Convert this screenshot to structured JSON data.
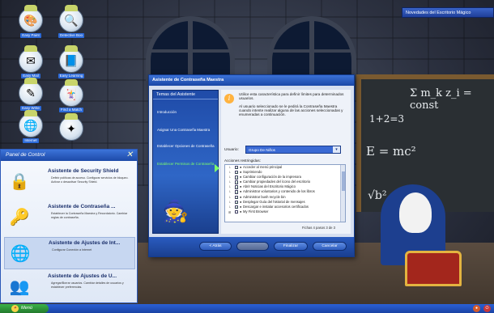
{
  "notification": {
    "text": "Novedades del Escritorio Mágico"
  },
  "desktop_icons": [
    {
      "label": "Easy Paint",
      "icon": "paint-icon",
      "glyph": "🎨"
    },
    {
      "label": "Detective Boo",
      "icon": "magnifier-icon",
      "glyph": "🔍"
    },
    {
      "label": "Easy Mail",
      "icon": "mail-icon",
      "glyph": "✉"
    },
    {
      "label": "Easy Learning",
      "icon": "book-icon",
      "glyph": "📘"
    },
    {
      "label": "Easy Write",
      "icon": "pencil-icon",
      "glyph": "✎"
    },
    {
      "label": "Internet",
      "icon": "globe-icon",
      "glyph": "🌐"
    },
    {
      "label": "Find a Match",
      "icon": "cards-icon",
      "glyph": "🃏"
    },
    {
      "label": "",
      "icon": "magic-icon",
      "glyph": "✦"
    },
    {
      "label": "",
      "icon": "globe-icon",
      "glyph": "🌍"
    }
  ],
  "control_panel": {
    "title": "Panel de Control",
    "items": [
      {
        "title": "Asistente de Security Shield",
        "icon": "shield-lock-icon",
        "glyph": "🔒",
        "desc": "Definir políticas de acceso. Configurar servicios de bloqueo. Activar o desactivar Security Shield."
      },
      {
        "title": "Asistente de Contraseña ...",
        "icon": "key-icon",
        "glyph": "🔑",
        "desc": "Establecer la Contraseña Maestra y Recordatorio. Cambiar reglas de contraseña."
      },
      {
        "title": "Asistente de Ajustes de Int...",
        "icon": "internet-globe-icon",
        "glyph": "🌐",
        "desc": "Configurar Conexión a Internet"
      },
      {
        "title": "Asistente de Ajustes de U...",
        "icon": "users-icon",
        "glyph": "👥",
        "desc": "Agregar/Borrar usuarios. Cambiar detalles de usuarios y establecer preferencias."
      }
    ]
  },
  "wizard": {
    "title": "Asistente de Contraseña Maestra",
    "sidebar_title": "Temas del Asistente",
    "steps": [
      {
        "label": "Introducción",
        "active": false
      },
      {
        "label": "Asignar Una Contraseña Maestra",
        "active": false
      },
      {
        "label": "Establecer Opciones de Contraseña",
        "active": false
      },
      {
        "label": "Establecer Permisos de Contraseña",
        "active": true
      }
    ],
    "description_1": "Utilice esta característica para definir límites para determinados usuarios.",
    "description_2": "Al usuario seleccionado se le pedirá la Contraseña Maestra cuando intente realizar alguna de las acciones seleccionadas y enumeradas a continuación.",
    "user_label": "Usuario:",
    "user_value": "Grupo De Niños",
    "actions_label": "Acciones restringidas:",
    "actions": [
      {
        "label": "Acceder al menú principal",
        "checked": true
      },
      {
        "label": "Suprimiendo",
        "checked": true
      },
      {
        "label": "Cambiar configuración de la impresora",
        "checked": true
      },
      {
        "label": "Cambiar propiedades del ícono del escritorio",
        "checked": true
      },
      {
        "label": "Abrir Noticias del Escritorio Mágico",
        "checked": true
      },
      {
        "label": "Administrar voluntarios y contenido de los libros",
        "checked": true
      },
      {
        "label": "Administrar bush recycle bin",
        "checked": true
      },
      {
        "label": "Desplegar Guía del historial de mensajes",
        "checked": true
      },
      {
        "label": "Descargar e instalar accesorios certificados",
        "checked": true
      },
      {
        "label": "My First Browser",
        "checked": false
      }
    ],
    "status": "Fichas 4 pasos 3 de 3",
    "buttons": {
      "back": "< Atrás",
      "next": "",
      "finish": "Finalizar",
      "cancel": "Cancelar"
    }
  },
  "taskbar": {
    "start_label": "Menú"
  },
  "blackboard": {
    "formula_1": "Σ m_k z_i = const",
    "formula_2": "1+2=3",
    "formula_3": "E = mc²",
    "formula_4": "√b²"
  }
}
